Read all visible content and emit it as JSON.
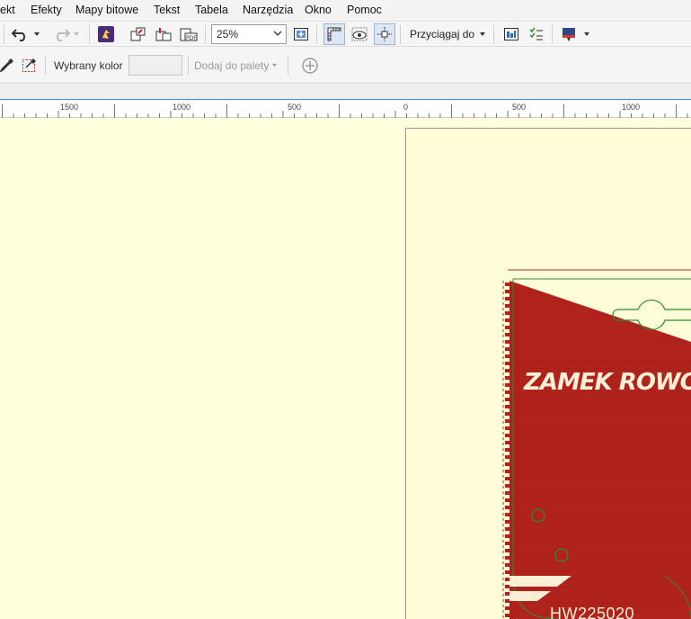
{
  "menu": {
    "items": [
      {
        "label": "ekt"
      },
      {
        "label": "Efekty"
      },
      {
        "label": "Mapy bitowe"
      },
      {
        "label": "Tekst"
      },
      {
        "label": "Tabela"
      },
      {
        "label": "Narzędzia"
      },
      {
        "label": "Okno"
      },
      {
        "label": "Pomoc"
      }
    ]
  },
  "toolbar": {
    "zoom_value": "25%",
    "snap_label": "Przyciągaj do",
    "icons": [
      "undo-icon",
      "redo-icon",
      "app-launcher-icon",
      "import-icon",
      "export-icon",
      "export-pdf-icon",
      "zoom-fit-icon",
      "rulers-icon",
      "view-icon",
      "guides-icon",
      "options-icon",
      "checklist-icon",
      "launch-icon"
    ]
  },
  "property_bar": {
    "selected_color_label": "Wybrany kolor",
    "add_to_palette_label": "Dodaj do palety",
    "selected_color_value": "",
    "icons": [
      "eyedropper-icon",
      "eyedropper-selection-icon",
      "add-circle-icon"
    ]
  },
  "ruler": {
    "labels": [
      "1500",
      "1000",
      "500",
      "0",
      "500",
      "1000"
    ]
  },
  "canvas": {
    "artwork_title": "ZAMEK ROWO",
    "artwork_code": "HW225020",
    "colors": {
      "desktop": "#fffedd",
      "artwork_red": "#b0231c",
      "artwork_text": "#fbefd6",
      "guide_green": "#2e8b2e"
    }
  }
}
